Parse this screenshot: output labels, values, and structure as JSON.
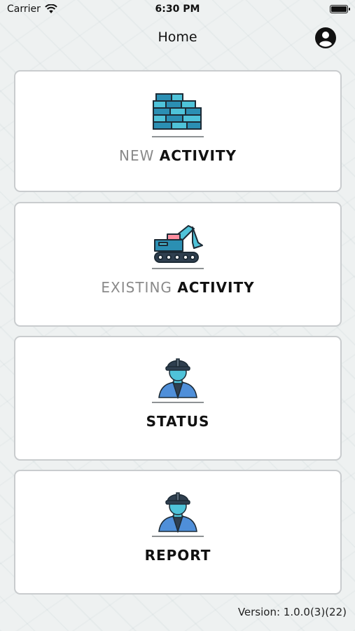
{
  "status_bar": {
    "carrier": "Carrier",
    "time": "6:30 PM"
  },
  "nav": {
    "title": "Home",
    "profile_icon": "user-circle-icon"
  },
  "cards": [
    {
      "light": "NEW",
      "bold": "ACTIVITY",
      "icon": "brick-wall-icon"
    },
    {
      "light": "EXISTING",
      "bold": "ACTIVITY",
      "icon": "excavator-icon"
    },
    {
      "light": "",
      "bold": "STATUS",
      "icon": "worker-icon"
    },
    {
      "light": "",
      "bold": "REPORT",
      "icon": "worker-icon"
    }
  ],
  "footer": {
    "version": "Version: 1.0.0(3)(22)"
  },
  "colors": {
    "accent": "#4fc3d9",
    "accent_dark": "#2b8fb3",
    "card_border": "#c9ccce",
    "dark_navy": "#2f3f4f"
  }
}
